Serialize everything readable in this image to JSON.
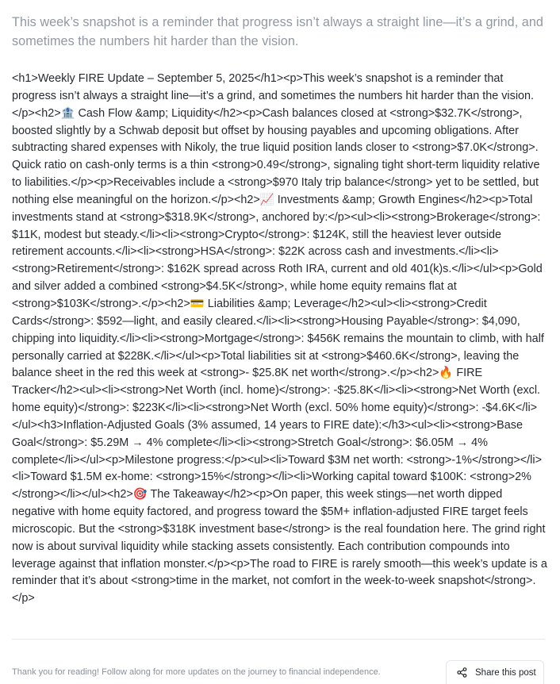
{
  "post": {
    "subtitle": "This week’s snapshot is a reminder that progress isn’t always a straight line—it’s a grind, and sometimes the numbers hit harder than the vision.",
    "raw_body": "<h1>Weekly FIRE Update – September 5, 2025</h1><p>This week’s snapshot is a reminder that progress isn’t always a straight line—it’s a grind, and sometimes the numbers hit harder than the vision.</p><h2>🏦 Cash Flow &amp; Liquidity</h2><p>Cash balances closed at <strong>$32.7K</strong>, boosted slightly by a Schwab deposit but offset by housing payables and upcoming obligations. After subtracting shared expenses with Nikoly, the true liquid position lands closer to <strong>$7.0K</strong>. Quick ratio on cash-only terms is a thin <strong>0.49</strong>, signaling tight short-term liquidity relative to liabilities.</p><p>Receivables include a <strong>$970 Italy trip balance</strong> yet to be settled, but nothing else meaningful on the horizon.</p><h2>📈 Investments &amp; Growth Engines</h2><p>Total investments stand at <strong>$318.9K</strong>, anchored by:</p><ul><li><strong>Brokerage</strong>: $11K, modest but steady.</li><li><strong>Crypto</strong>: $124K, still the heaviest lever outside retirement accounts.</li><li><strong>HSA</strong>: $22K across cash and investments.</li><li><strong>Retirement</strong>: $162K spread across Roth IRA, current and old 401(k)s.</li></ul><p>Gold and silver added a combined <strong>$4.5K</strong>, while home equity remains flat at <strong>$103K</strong>.</p><h2>💳 Liabilities &amp; Leverage</h2><ul><li><strong>Credit Cards</strong>: $592—light, and easily cleared.</li><li><strong>Housing Payable</strong>: $4,090, chipping into liquidity.</li><li><strong>Mortgage</strong>: $456K remains the mountain to climb, with half personally carried at $228K.</li></ul><p>Total liabilities sit at <strong>$460.6K</strong>, leaving the balance sheet in the red this week at <strong>- $25.8K net worth</strong>.</p><h2>🔥 FIRE Tracker</h2><ul><li><strong>Net Worth (incl. home)</strong>: -$25.8K</li><li><strong>Net Worth (excl. home equity)</strong>: $223K</li><li><strong>Net Worth (excl. 50% home equity)</strong>: -$4.6K</li></ul><h3>Inflation-Adjusted Goals (3% assumed, 14 years to FIRE date):</h3><ul><li><strong>Base Goal</strong>: $5.29M → 4% complete</li><li><strong>Stretch Goal</strong>: $6.05M → 4% complete</li></ul><p>Milestone progress:</p><ul><li>Toward $3M net worth: <strong>-1%</strong></li><li>Toward $1.5M ex-home: <strong>15%</strong></li><li>Working capital toward $100K: <strong>2%</strong></li></ul><h2>🎯 The Takeaway</h2><p>On paper, this week stings—net worth dipped negative with home equity factored, and progress toward the $5M+ inflation-adjusted FIRE target feels microscopic. But the <strong>$318K investment base</strong> is the real foundation here. The grind right now is about survival liquidity while stacking assets consistently. Each contribution compounds into leverage against that inflation monster.</p><p>The road to FIRE is rarely smooth—this week’s update is a reminder that it’s about <strong>time in the market, not comfort in the week-to-week snapshot</strong>.</p>"
  },
  "footer": {
    "note": "Thank you for reading! Follow along for more updates on the journey to financial independence.",
    "share_label": "Share this post",
    "share_icon": "share-icon"
  },
  "colors": {
    "subtitle": "#9198a1",
    "body_text": "#262a31",
    "divider": "#e6e8eb",
    "footer_text": "#8a9099"
  }
}
